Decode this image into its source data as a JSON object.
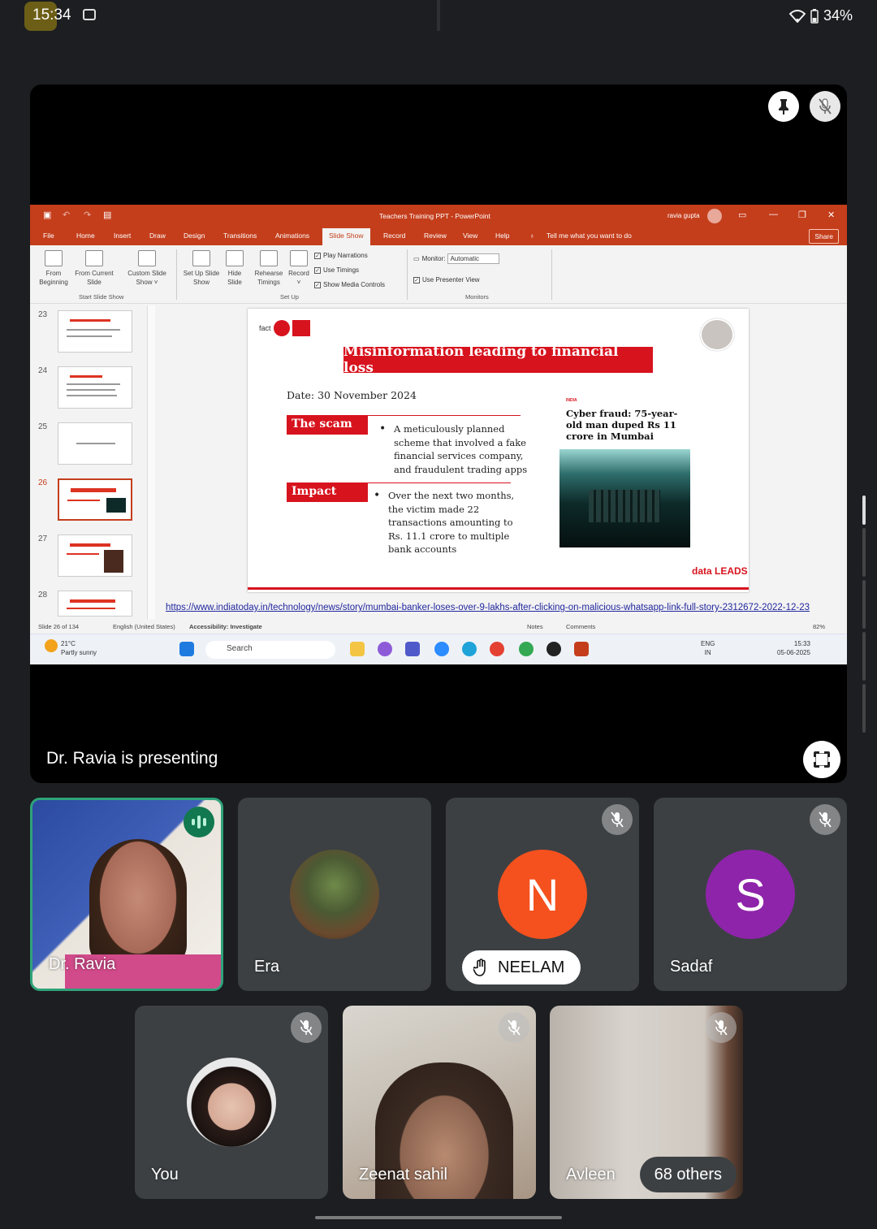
{
  "status_bar": {
    "time": "15:34",
    "battery": "34%"
  },
  "stage": {
    "presenting_label": "Dr. Ravia is presenting",
    "pin_icon": "pin-icon",
    "mic_off_icon": "mic-off-icon"
  },
  "powerpoint": {
    "window_title": "Teachers Training PPT - PowerPoint",
    "user": "ravia gupta",
    "tabs": [
      "File",
      "Home",
      "Insert",
      "Draw",
      "Design",
      "Transitions",
      "Animations",
      "Slide Show",
      "Record",
      "Review",
      "View",
      "Help"
    ],
    "tell_me": "Tell me what you want to do",
    "share": "Share",
    "ribbon": {
      "from_beginning": "From Beginning",
      "from_current": "From Current Slide",
      "custom_show": "Custom Slide Show ˅",
      "group_start": "Start Slide Show",
      "set_up": "Set Up Slide Show",
      "hide_slide": "Hide Slide",
      "rehearse": "Rehearse Timings",
      "record": "Record ˅",
      "group_setup": "Set Up",
      "play_narrations": "Play Narrations",
      "use_timings": "Use Timings",
      "show_media": "Show Media Controls",
      "monitor_label": "Monitor:",
      "monitor_value": "Automatic",
      "use_presenter": "Use Presenter View",
      "group_monitors": "Monitors"
    },
    "thumbnail_numbers": [
      "23",
      "24",
      "25",
      "26",
      "27",
      "28"
    ],
    "slide": {
      "logo_text": "fact",
      "title": "Misinformation leading to financial loss",
      "date": "Date: 30 November 2024",
      "scam_label": "The scam",
      "scam_text": "A meticulously planned scheme that involved a fake financial services company, and fraudulent trading apps",
      "impact_label": "Impact",
      "impact_text": "Over the next two months, the victim made 22 transactions amounting to Rs. 11.1 crore to multiple bank accounts",
      "news_tag": "INDIA",
      "news_headline": "Cyber fraud: 75-year-old man duped Rs 11 crore in Mumbai",
      "footer_logo": "data LEADS"
    },
    "notes_link": "https://www.indiatoday.in/technology/news/story/mumbai-banker-loses-over-9-lakhs-after-clicking-on-malicious-whatsapp-link-full-story-2312672-2022-12-23",
    "status": {
      "slide_of": "Slide 26 of 134",
      "language": "English (United States)",
      "accessibility": "Accessibility: Investigate",
      "notes": "Notes",
      "comments": "Comments",
      "zoom": "82%"
    },
    "taskbar": {
      "weather_temp": "21°C",
      "weather_desc": "Partly sunny",
      "search": "Search",
      "lang1": "ENG",
      "lang2": "IN",
      "clock_time": "15:33",
      "clock_date": "05-06-2025"
    }
  },
  "participants": [
    {
      "name": "Dr. Ravia"
    },
    {
      "name": "Era"
    },
    {
      "name": "NEELAM",
      "initial": "N",
      "color": "#f4511e"
    },
    {
      "name": "Sadaf",
      "initial": "S",
      "color": "#8e24aa"
    },
    {
      "name": "You"
    },
    {
      "name": "Zeenat sahil"
    },
    {
      "name": "Avleen"
    }
  ],
  "others_label": "68 others"
}
